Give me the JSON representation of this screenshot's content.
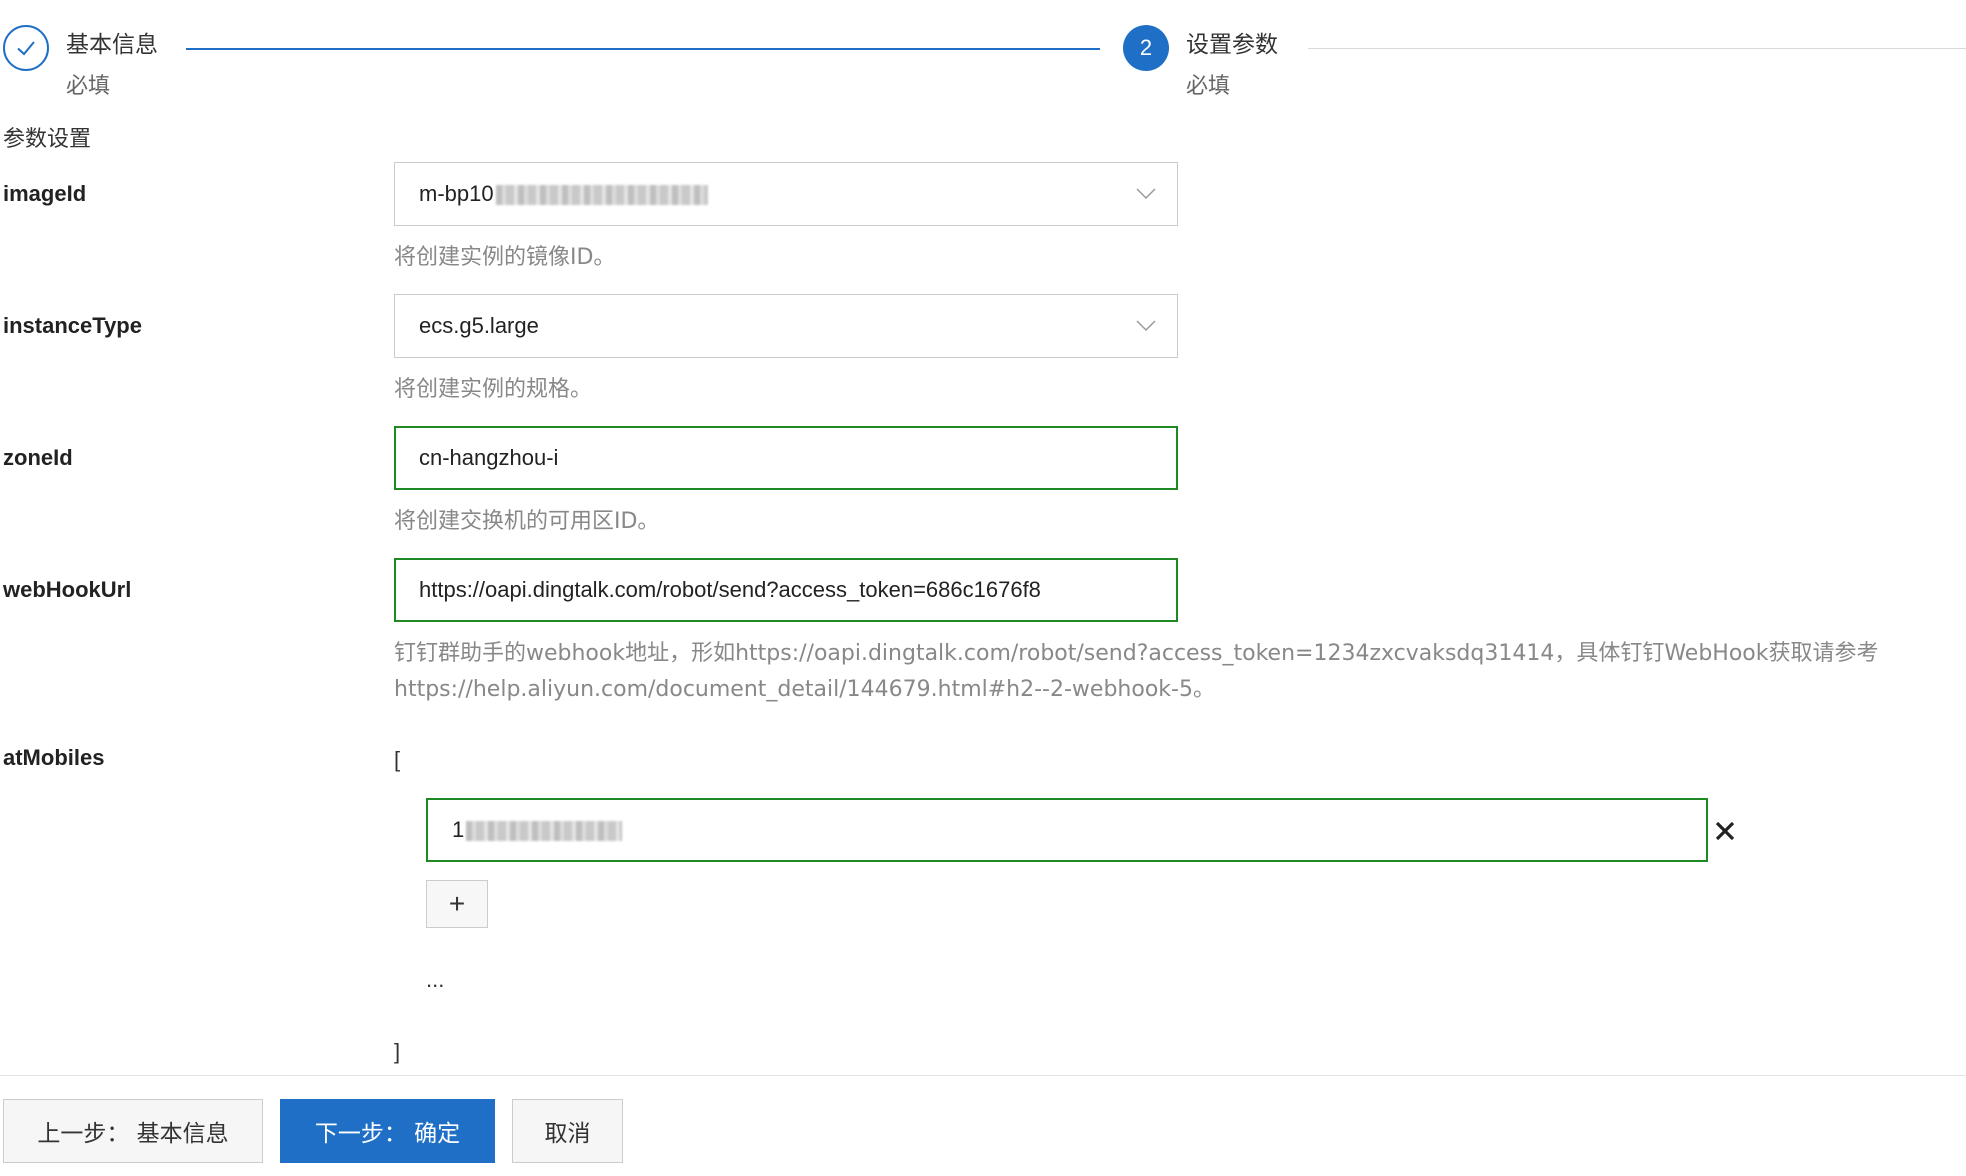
{
  "steps": [
    {
      "title": "基本信息",
      "subtitle": "必填",
      "status": "done",
      "icon": "check-icon"
    },
    {
      "number": "2",
      "title": "设置参数",
      "subtitle": "必填",
      "status": "current"
    }
  ],
  "section_title": "参数设置",
  "fields": {
    "imageId": {
      "label": "imageId",
      "value": "m-bp10",
      "help": "将创建实例的镜像ID。"
    },
    "instanceType": {
      "label": "instanceType",
      "value": "ecs.g5.large",
      "help": "将创建实例的规格。"
    },
    "zoneId": {
      "label": "zoneId",
      "value": "cn-hangzhou-i",
      "help": "将创建交换机的可用区ID。"
    },
    "webHookUrl": {
      "label": "webHookUrl",
      "value": "https://oapi.dingtalk.com/robot/send?access_token=686c1676f8",
      "help_line1": "钉钉群助手的webhook地址，形如https://oapi.dingtalk.com/robot/send?access_token=1234zxcvaksdq31414，具体钉钉WebHook获取请参考",
      "help_line2": "https://help.aliyun.com/document_detail/144679.html#h2--2-webhook-5。"
    },
    "atMobiles": {
      "label": "atMobiles",
      "open_bracket": "[",
      "close_bracket": "]",
      "items": [
        "1"
      ],
      "add_label": "+",
      "ellipsis": "..."
    }
  },
  "footer": {
    "prev_label": "上一步： 基本信息",
    "next_label": "下一步： 确定",
    "cancel_label": "取消"
  },
  "colors": {
    "primary": "#1e6fc5",
    "valid_border": "#1d8a23",
    "help_text": "#888888"
  }
}
